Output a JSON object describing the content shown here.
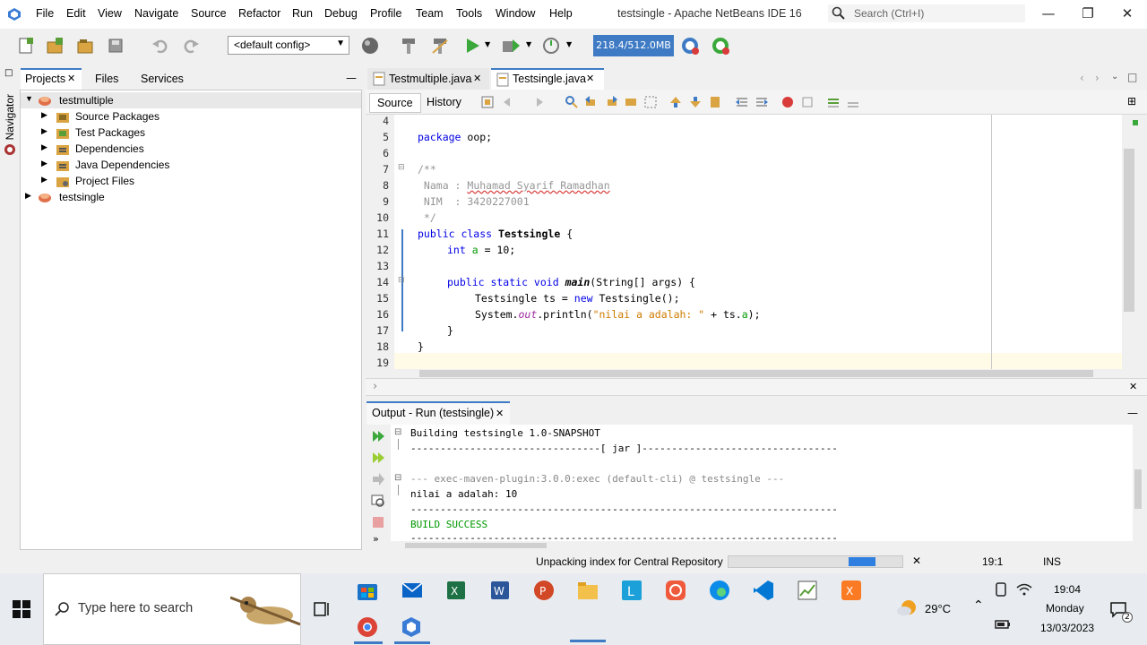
{
  "window": {
    "title": "testsingle - Apache NetBeans IDE 16",
    "search_placeholder": "Search (Ctrl+I)",
    "menu": [
      "File",
      "Edit",
      "View",
      "Navigate",
      "Source",
      "Refactor",
      "Run",
      "Debug",
      "Profile",
      "Team",
      "Tools",
      "Window",
      "Help"
    ]
  },
  "toolbar": {
    "config": "<default config>",
    "memory": "218.4/512.0MB"
  },
  "navigator_label": "Navigator",
  "projects": {
    "tabs": [
      "Projects",
      "Files",
      "Services"
    ],
    "tree": [
      "testmultiple",
      "Source Packages",
      "Test Packages",
      "Dependencies",
      "Java Dependencies",
      "Project Files",
      "testsingle"
    ]
  },
  "editor": {
    "tabs": [
      "Testmultiple.java",
      "Testsingle.java"
    ],
    "source_btn": "Source",
    "history_btn": "History",
    "line_numbers": [
      "4",
      "5",
      "6",
      "7",
      "8",
      "9",
      "10",
      "11",
      "12",
      "13",
      "14",
      "15",
      "16",
      "17",
      "18",
      "19"
    ],
    "code": {
      "l5a": "package",
      "l5b": " oop;",
      "l7": "/**",
      "l8a": " Nama : ",
      "l8b": "Muhamad Syarif Ramadhan",
      "l9": " NIM  : 3420227001",
      "l10": " */",
      "l11a": "public class ",
      "l11b": "Testsingle",
      "l11c": " {",
      "l12a": "int ",
      "l12b": "a",
      "l12c": " = 10;",
      "l14a": "public static void ",
      "l14b": "main",
      "l14c": "(String[] args) {",
      "l15a": "Testsingle ts = ",
      "l15b": "new",
      "l15c": " Testsingle();",
      "l16a": "System.",
      "l16b": "out",
      "l16c": ".println(",
      "l16d": "\"nilai a adalah: \"",
      "l16e": " + ts.",
      "l16f": "a",
      "l16g": ");",
      "l17": "}",
      "l18": "}"
    }
  },
  "output": {
    "tab": "Output - Run (testsingle)",
    "lines": [
      "Building testsingle 1.0-SNAPSHOT",
      "--------------------------------[ jar ]---------------------------------",
      "",
      "--- exec-maven-plugin:3.0.0:exec (default-cli) @ testsingle ---",
      "nilai a adalah: 10",
      "------------------------------------------------------------------------",
      "BUILD SUCCESS",
      "------------------------------------------------------------------------"
    ]
  },
  "status": {
    "task": "Unpacking index for Central Repository",
    "progress_fraction": 0.85,
    "position": "19:1",
    "mode": "INS"
  },
  "taskbar": {
    "search_placeholder": "Type here to search",
    "weather": "29°C",
    "time": "19:04",
    "day": "Monday",
    "date": "13/03/2023",
    "notif_count": "2"
  },
  "colors": {
    "accent": "#3f7bc4",
    "keyword": "#0000e6",
    "comment": "#969696",
    "string": "#ce7b00",
    "field": "#009900",
    "success": "#009900"
  }
}
